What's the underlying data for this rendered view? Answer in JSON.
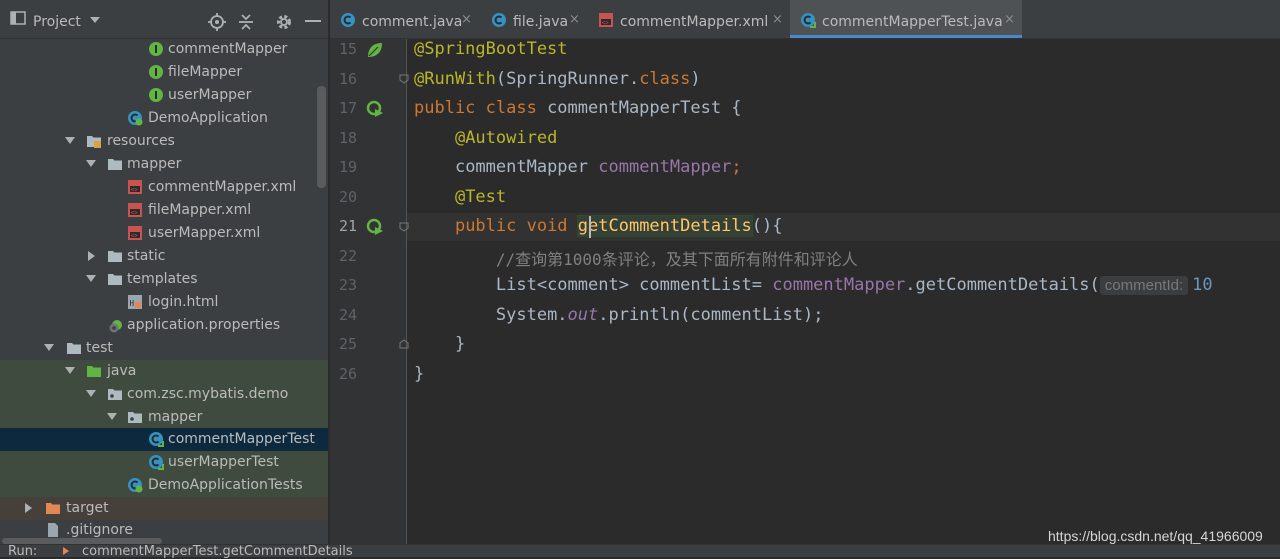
{
  "project_panel": {
    "title": "Project",
    "tree": [
      {
        "label": "commentMapper",
        "kind": "interface"
      },
      {
        "label": "fileMapper",
        "kind": "interface"
      },
      {
        "label": "userMapper",
        "kind": "interface"
      },
      {
        "label": "DemoApplication",
        "kind": "spring-class"
      },
      {
        "label": "resources",
        "kind": "resources-folder"
      },
      {
        "label": "mapper",
        "kind": "folder"
      },
      {
        "label": "commentMapper.xml",
        "kind": "xml"
      },
      {
        "label": "fileMapper.xml",
        "kind": "xml"
      },
      {
        "label": "userMapper.xml",
        "kind": "xml"
      },
      {
        "label": "static",
        "kind": "folder"
      },
      {
        "label": "templates",
        "kind": "folder"
      },
      {
        "label": "login.html",
        "kind": "html"
      },
      {
        "label": "application.properties",
        "kind": "properties"
      },
      {
        "label": "test",
        "kind": "folder"
      },
      {
        "label": "java",
        "kind": "test-source-folder"
      },
      {
        "label": "com.zsc.mybatis.demo",
        "kind": "package"
      },
      {
        "label": "mapper",
        "kind": "package"
      },
      {
        "label": "commentMapperTest",
        "kind": "test-class"
      },
      {
        "label": "userMapperTest",
        "kind": "test-class"
      },
      {
        "label": "DemoApplicationTests",
        "kind": "spring-class"
      },
      {
        "label": "target",
        "kind": "excluded-folder"
      },
      {
        "label": ".gitignore",
        "kind": "file"
      }
    ]
  },
  "tabs": [
    {
      "label": "comment.java",
      "close": "×"
    },
    {
      "label": "file.java",
      "close": "×"
    },
    {
      "label": "commentMapper.xml",
      "close": "×"
    },
    {
      "label": "commentMapperTest.java",
      "close": "×"
    }
  ],
  "editor": {
    "line_numbers": [
      "15",
      "16",
      "17",
      "18",
      "19",
      "20",
      "21",
      "22",
      "23",
      "24",
      "25",
      "26"
    ],
    "code": {
      "l15": {
        "a": "@SpringBootTest"
      },
      "l16": {
        "a": "@RunWith",
        "b": "(SpringRunner.",
        "c": "class",
        "d": ")"
      },
      "l17": {
        "a": "public class ",
        "b": "commentMapperTest {"
      },
      "l18": {
        "a": "@Autowired"
      },
      "l19": {
        "a": "commentMapper ",
        "b": "commentMapper",
        "c": ";"
      },
      "l20": {
        "a": "@Test"
      },
      "l21": {
        "a": "public void ",
        "b": "getCommentDetails",
        "c": "(){"
      },
      "l22": {
        "a": "//查询第1000条评论，及其下面所有附件和评论人"
      },
      "l23": {
        "a": "List<comment> commentList= ",
        "b": "commentMapper",
        "c": ".getCommentDetails(",
        "hint": "commentId:",
        "num": "10"
      },
      "l24": {
        "a": "System.",
        "b": "out",
        "c": ".println(commentList);"
      },
      "l25": {
        "a": "}"
      },
      "l26": {
        "a": "}"
      }
    }
  },
  "run_bar": {
    "label": "Run:",
    "config": "commentMapperTest.getCommentDetails"
  },
  "watermark": "https://blog.csdn.net/qq_41966009",
  "colors": {
    "background": "#2b2b2b",
    "panel": "#3c3f41",
    "accent": "#4a88c7",
    "selected_row": "#0d293e"
  }
}
